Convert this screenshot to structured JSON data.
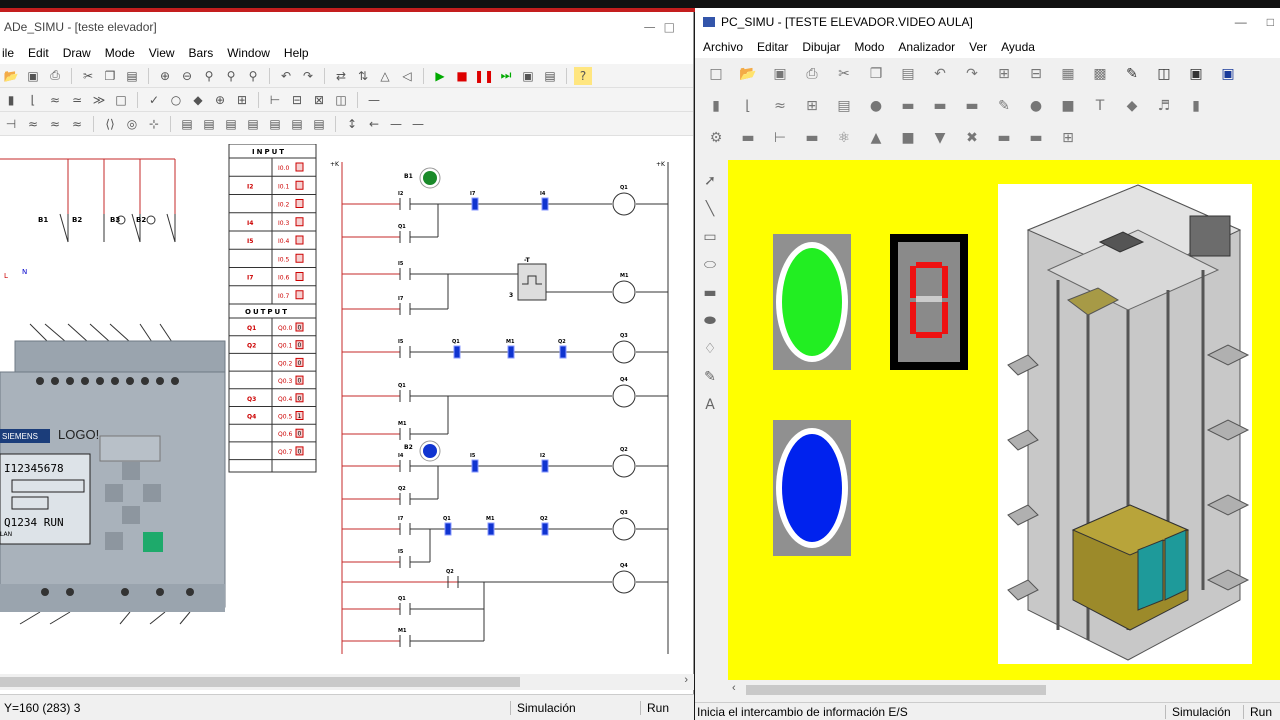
{
  "left_window": {
    "title": "ADe_SIMU - [teste elevador]",
    "menu": [
      "ile",
      "Edit",
      "Draw",
      "Mode",
      "View",
      "Bars",
      "Window",
      "Help"
    ],
    "io_table": {
      "input_header": "INPUT",
      "output_header": "OUTPUT",
      "inputs": [
        {
          "tag": "",
          "addr": "I0.0"
        },
        {
          "tag": "I2",
          "addr": "I0.1"
        },
        {
          "tag": "",
          "addr": "I0.2"
        },
        {
          "tag": "I4",
          "addr": "I0.3"
        },
        {
          "tag": "I5",
          "addr": "I0.4"
        },
        {
          "tag": "",
          "addr": "I0.5"
        },
        {
          "tag": "I7",
          "addr": "I0.6"
        },
        {
          "tag": "",
          "addr": "I0.7"
        }
      ],
      "outputs": [
        {
          "tag": "Q1",
          "addr": "Q0.0",
          "val": "0"
        },
        {
          "tag": "Q2",
          "addr": "Q0.1",
          "val": "0"
        },
        {
          "tag": "",
          "addr": "Q0.2",
          "val": "0"
        },
        {
          "tag": "",
          "addr": "Q0.3",
          "val": "0"
        },
        {
          "tag": "Q3",
          "addr": "Q0.4",
          "val": "0"
        },
        {
          "tag": "Q4",
          "addr": "Q0.5",
          "val": "1"
        },
        {
          "tag": "",
          "addr": "Q0.6",
          "val": "0"
        },
        {
          "tag": "",
          "addr": "Q0.7",
          "val": "0"
        }
      ]
    },
    "plc": {
      "brand": "SIEMENS",
      "model": "LOGO!",
      "display_line1": "I12345678",
      "display_line3": "Q1234 RUN",
      "lan_label": "LAN"
    },
    "wiring_labels": {
      "b1": "B1",
      "b2": "B2",
      "b3": "B3",
      "l": "L",
      "n": "N"
    },
    "ladder_labels": {
      "b1": "B1",
      "b2": "B2",
      "t": "-T",
      "t_num": "3",
      "i2": "I2",
      "i4": "I4",
      "i5": "I5",
      "i7": "I7",
      "q1": "Q1",
      "q2": "Q2",
      "q3": "Q3",
      "q4": "Q4",
      "m1": "M1"
    },
    "status": {
      "coords": "Y=160 (283) 3",
      "mode": "Simulación",
      "state": "Run"
    }
  },
  "right_window": {
    "title": "PC_SIMU - [TESTE ELEVADOR.VIDEO AULA]",
    "menu": [
      "Archivo",
      "Editar",
      "Dibujar",
      "Modo",
      "Analizador",
      "Ver",
      "Ayuda"
    ],
    "status": {
      "message": "Inicia el intercambio de información E/S",
      "mode": "Simulación",
      "state": "Run"
    },
    "colors": {
      "canvas": "#ffff00",
      "green_lamp": "#22ee22",
      "blue_lamp": "#0022ee",
      "seg": "#ee1111"
    }
  }
}
